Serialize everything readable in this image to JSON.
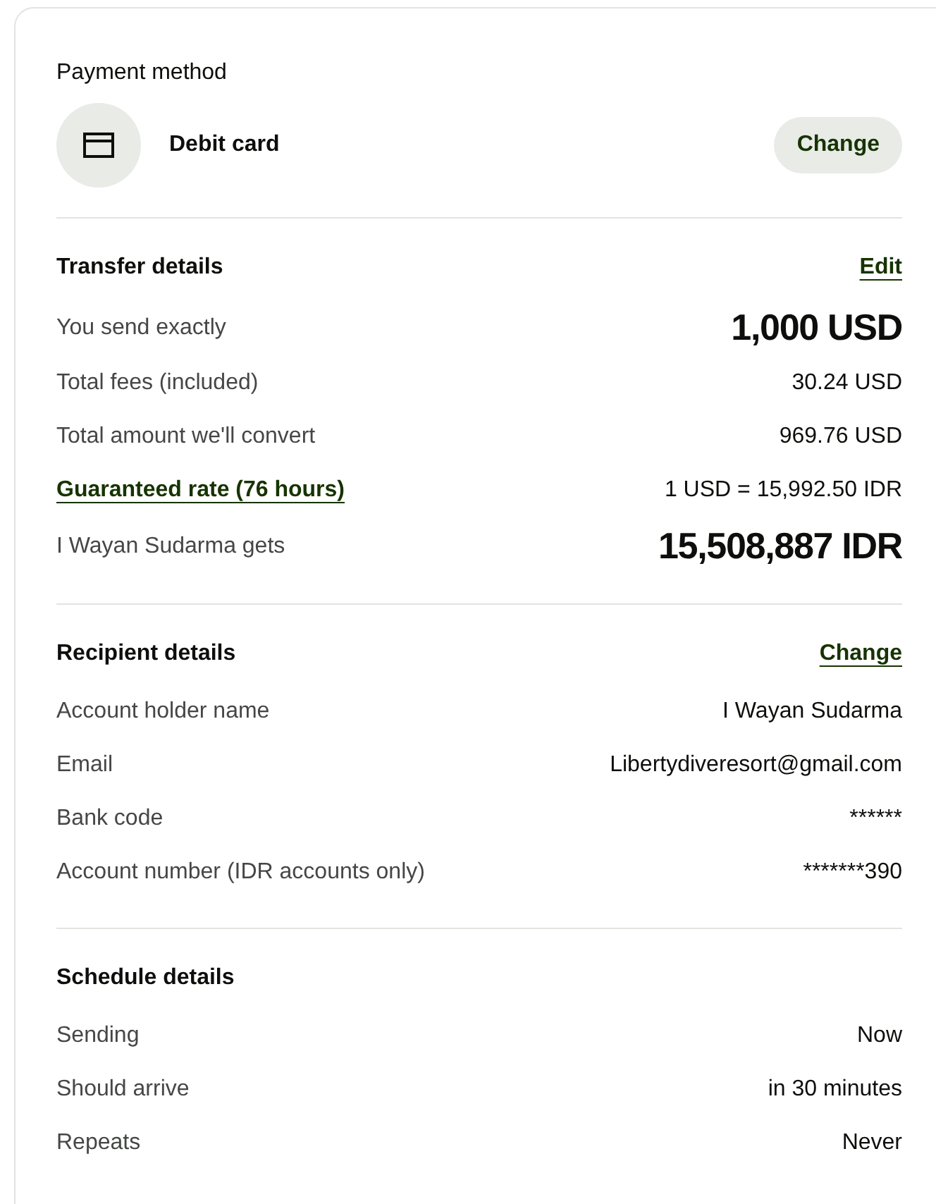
{
  "payment_method": {
    "title": "Payment method",
    "method": "Debit card",
    "change_button": "Change"
  },
  "sections": [
    {
      "title": "Transfer details",
      "action": "Edit",
      "rows": [
        {
          "kind": "large",
          "label": "You send exactly",
          "value": "1,000 USD"
        },
        {
          "kind": "plain",
          "label": "Total fees (included)",
          "value": "30.24 USD"
        },
        {
          "kind": "plain",
          "label": "Total amount we'll convert",
          "value": "969.76 USD"
        },
        {
          "kind": "link",
          "label": "Guaranteed rate (76 hours)",
          "value": "1 USD = 15,992.50 IDR"
        },
        {
          "kind": "large",
          "label": "I Wayan Sudarma gets",
          "value": "15,508,887 IDR"
        }
      ]
    },
    {
      "title": "Recipient details",
      "action": "Change",
      "rows": [
        {
          "kind": "plain",
          "label": "Account holder name",
          "value": "I Wayan Sudarma"
        },
        {
          "kind": "plain",
          "label": "Email",
          "value": "Libertydiveresort@gmail.com"
        },
        {
          "kind": "plain",
          "label": "Bank code",
          "value": "******"
        },
        {
          "kind": "plain",
          "label": "Account number (IDR accounts only)",
          "value": "*******390"
        }
      ]
    },
    {
      "title": "Schedule details",
      "rows": [
        {
          "kind": "plain",
          "label": "Sending",
          "value": "Now"
        },
        {
          "kind": "plain",
          "label": "Should arrive",
          "value": "in 30 minutes"
        },
        {
          "kind": "plain",
          "label": "Repeats",
          "value": "Never"
        }
      ]
    }
  ]
}
